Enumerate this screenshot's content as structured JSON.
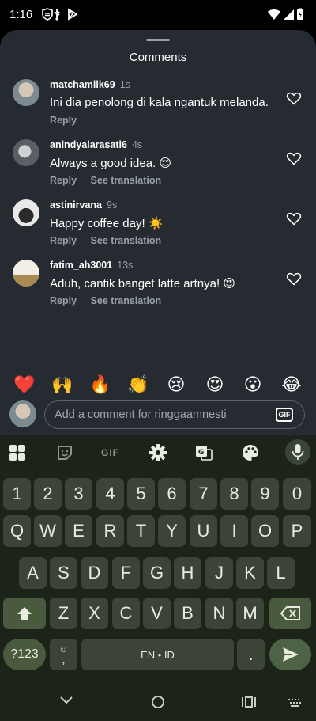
{
  "status_bar": {
    "time": "1:16",
    "icons": [
      "shield-icon",
      "usb-icon",
      "play-store-icon",
      "wifi-icon",
      "signal-icon",
      "battery-icon"
    ]
  },
  "sheet": {
    "title": "Comments",
    "comments": [
      {
        "user": "matchamilk69",
        "time": "1s",
        "text": "Ini dia penolong di kala ngantuk melanda.",
        "actions": [
          "Reply"
        ]
      },
      {
        "user": "anindyalarasati6",
        "time": "4s",
        "text": "Always a good idea. 😌",
        "actions": [
          "Reply",
          "See translation"
        ]
      },
      {
        "user": "astinirvana",
        "time": "9s",
        "text": "Happy coffee day! ☀️",
        "actions": [
          "Reply",
          "See translation"
        ]
      },
      {
        "user": "fatim_ah3001",
        "time": "13s",
        "text": "Aduh, cantik banget latte artnya! 😍",
        "actions": [
          "Reply",
          "See translation"
        ]
      }
    ],
    "quick_emojis": [
      "❤️",
      "🙌",
      "🔥",
      "👏",
      "😢",
      "😍",
      "😮",
      "😂"
    ],
    "input": {
      "placeholder": "Add a comment for ringgaamnesti",
      "gif_label": "GIF"
    }
  },
  "keyboard": {
    "toolbar": [
      "apps-grid-icon",
      "sticker-icon",
      "gif-icon",
      "settings-icon",
      "translate-icon",
      "palette-icon",
      "mic-icon"
    ],
    "toolbar_gif_label": "GIF",
    "row_numbers": [
      "1",
      "2",
      "3",
      "4",
      "5",
      "6",
      "7",
      "8",
      "9",
      "0"
    ],
    "row_top": [
      "Q",
      "W",
      "E",
      "R",
      "T",
      "Y",
      "U",
      "I",
      "O",
      "P"
    ],
    "row_middle": [
      "A",
      "S",
      "D",
      "F",
      "G",
      "H",
      "J",
      "K",
      "L"
    ],
    "row_bottom": [
      "Z",
      "X",
      "C",
      "V",
      "B",
      "N",
      "M"
    ],
    "sym_label": "?123",
    "comma_label": ",",
    "space_label": "EN • ID",
    "period_label": "."
  },
  "colors": {
    "sheet_bg": "#262a31",
    "keyboard_bg": "#1c2319",
    "key_bg": "#3c4438",
    "accent_key": "#495a3e",
    "text_secondary": "#9aa0a8"
  }
}
